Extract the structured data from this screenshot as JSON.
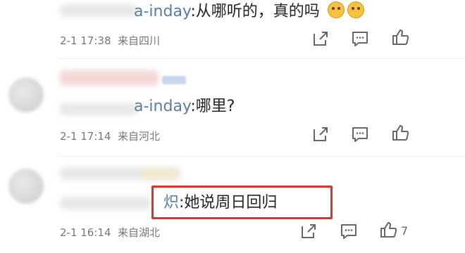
{
  "comments": [
    {
      "mention_fragment": "a-inday",
      "text": ":从哪听的，真的吗",
      "time": "2-1 17:38",
      "location": "来自四川",
      "emoji": "crying-face"
    },
    {
      "mention_fragment": "a-inday",
      "text": ":哪里?",
      "time": "2-1 17:14",
      "location": "来自河北"
    },
    {
      "mention_fragment": "炽",
      "text": ":她说周日回归",
      "time": "2-1 16:14",
      "location": "来自湖北",
      "like_count": "7"
    }
  ],
  "colors": {
    "highlight": "#d9342b",
    "mention": "#5a7aa8"
  }
}
